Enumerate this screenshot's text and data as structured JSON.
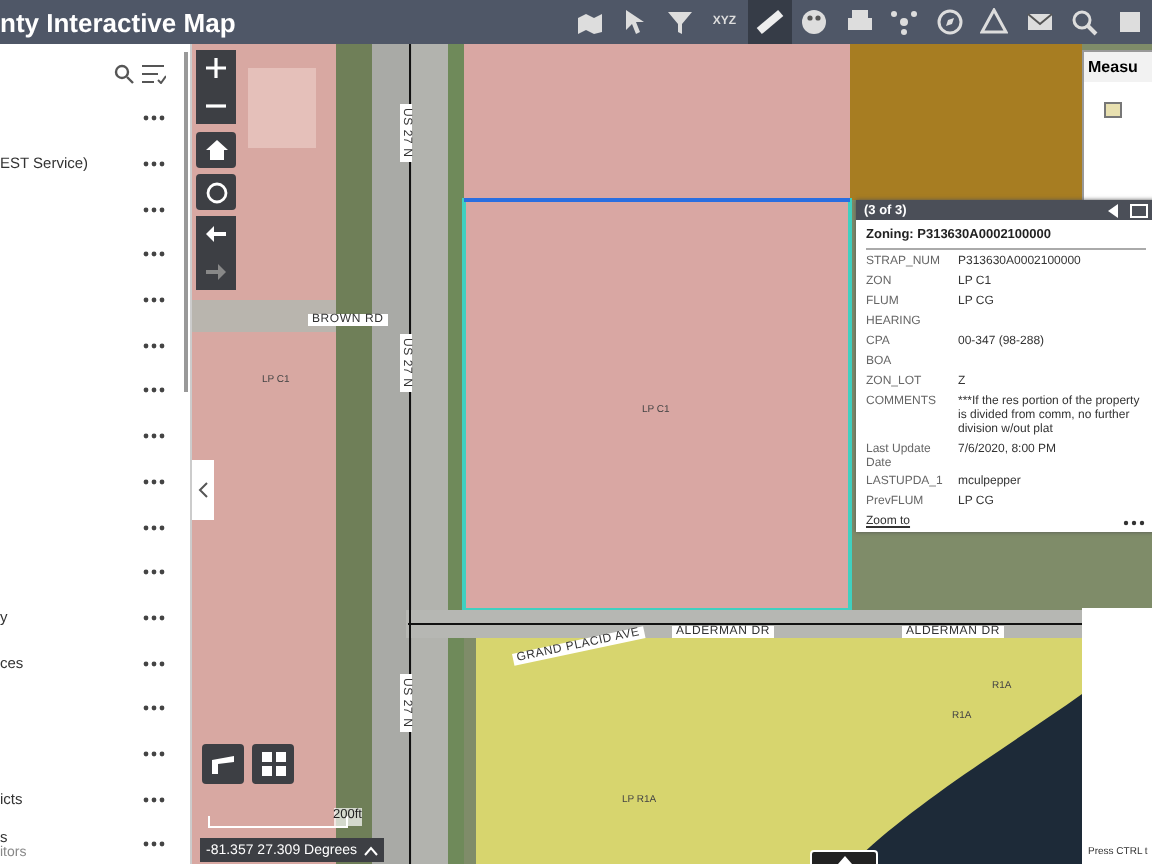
{
  "header": {
    "title": "nty Interactive Map",
    "tools": [
      {
        "selected": false
      },
      {
        "selected": false
      },
      {
        "selected": false
      },
      {
        "selected": false,
        "label": "XYZ"
      },
      {
        "selected": true
      },
      {
        "selected": false
      },
      {
        "selected": false
      },
      {
        "selected": false
      },
      {
        "selected": false
      },
      {
        "selected": false
      },
      {
        "selected": false
      },
      {
        "selected": false
      },
      {
        "selected": false
      }
    ]
  },
  "layer_list": {
    "rows": [
      {},
      {
        "label": "EST Service)"
      },
      {},
      {},
      {},
      {},
      {},
      {},
      {},
      {},
      {},
      {
        "label": "y"
      },
      {
        "label": "ces"
      },
      {},
      {},
      {
        "label": "icts"
      },
      {
        "label": "s",
        "sublabel": "itors"
      }
    ]
  },
  "map": {
    "labels": [
      {
        "kind": "road",
        "text": "BROWN RD"
      },
      {
        "kind": "road",
        "text": "US 27 N"
      },
      {
        "kind": "road",
        "text": "US 27 N"
      },
      {
        "kind": "road",
        "text": "US 27 N"
      },
      {
        "kind": "road",
        "text": "ALDERMAN DR"
      },
      {
        "kind": "road",
        "text": "ALDERMAN DR"
      },
      {
        "kind": "road",
        "text": "GRAND PLACID AVE"
      },
      {
        "kind": "zone",
        "text": "LP C1"
      },
      {
        "kind": "zone",
        "text": "LP C1"
      },
      {
        "kind": "zone",
        "text": "LP R1A"
      },
      {
        "kind": "zone",
        "text": "R1A"
      },
      {
        "kind": "zone",
        "text": "R1A"
      }
    ],
    "scale": "200ft",
    "coordinates": "-81.357 27.309 Degrees",
    "hint": "Press CTRL t"
  },
  "measure_panel": {
    "title": "Measu"
  },
  "popup": {
    "counter": "(3 of 3)",
    "title": "Zoning: P313630A0002100000",
    "fields": [
      {
        "name": "STRAP_NUM",
        "value": "P313630A0002100000"
      },
      {
        "name": "ZON",
        "value": "LP C1"
      },
      {
        "name": "FLUM",
        "value": "LP CG"
      },
      {
        "name": "HEARING"
      },
      {
        "name": "CPA",
        "value": "00-347 (98-288)"
      },
      {
        "name": "BOA"
      },
      {
        "name": "ZON_LOT",
        "value": "Z"
      },
      {
        "name": "COMMENTS",
        "value": "***If the res portion of the property is divided from comm, no further division w/out plat"
      },
      {
        "name": "Last Update Date",
        "value": "7/6/2020, 8:00 PM"
      },
      {
        "name": "LASTUPDA_1",
        "value": "mculpepper"
      },
      {
        "name": "PrevFLUM",
        "value": "LP CG"
      }
    ],
    "link": "Zoom to"
  }
}
